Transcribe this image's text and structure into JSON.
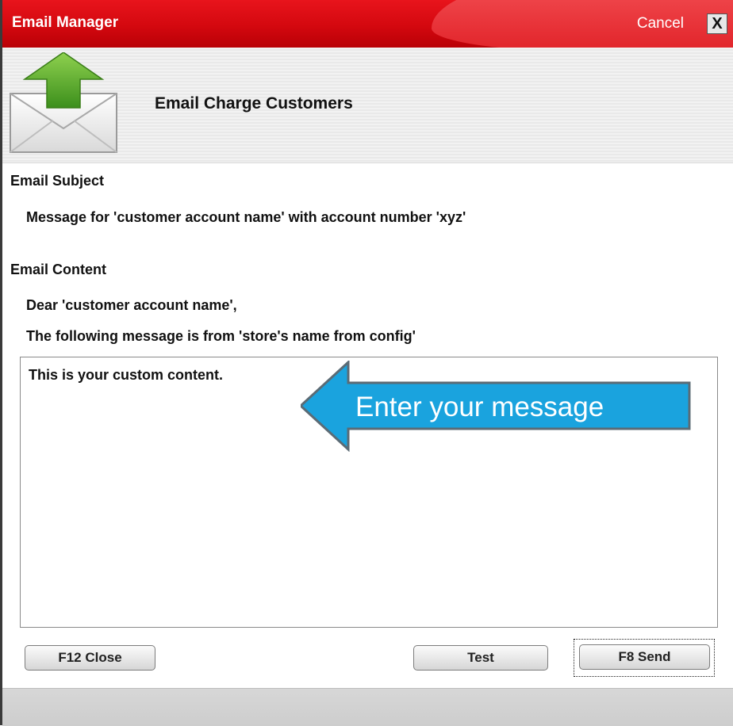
{
  "window": {
    "title": "Email Manager",
    "cancel_label": "Cancel",
    "close_glyph": "X"
  },
  "header": {
    "title": "Email Charge Customers",
    "icon": "email-send-icon"
  },
  "subject": {
    "label": "Email Subject",
    "value": "Message for 'customer account name' with account number 'xyz'"
  },
  "content": {
    "label": "Email Content",
    "greeting": "Dear 'customer account name',",
    "intro": "The following message is from 'store's name from config'",
    "custom_text": "This is your custom content."
  },
  "callout": {
    "text": "Enter your message",
    "color": "#1aa3de"
  },
  "buttons": {
    "close": "F12 Close",
    "test": "Test",
    "send": "F8 Send"
  },
  "colors": {
    "titlebar": "#d4080f",
    "arrow_green": "#5aa92a"
  }
}
